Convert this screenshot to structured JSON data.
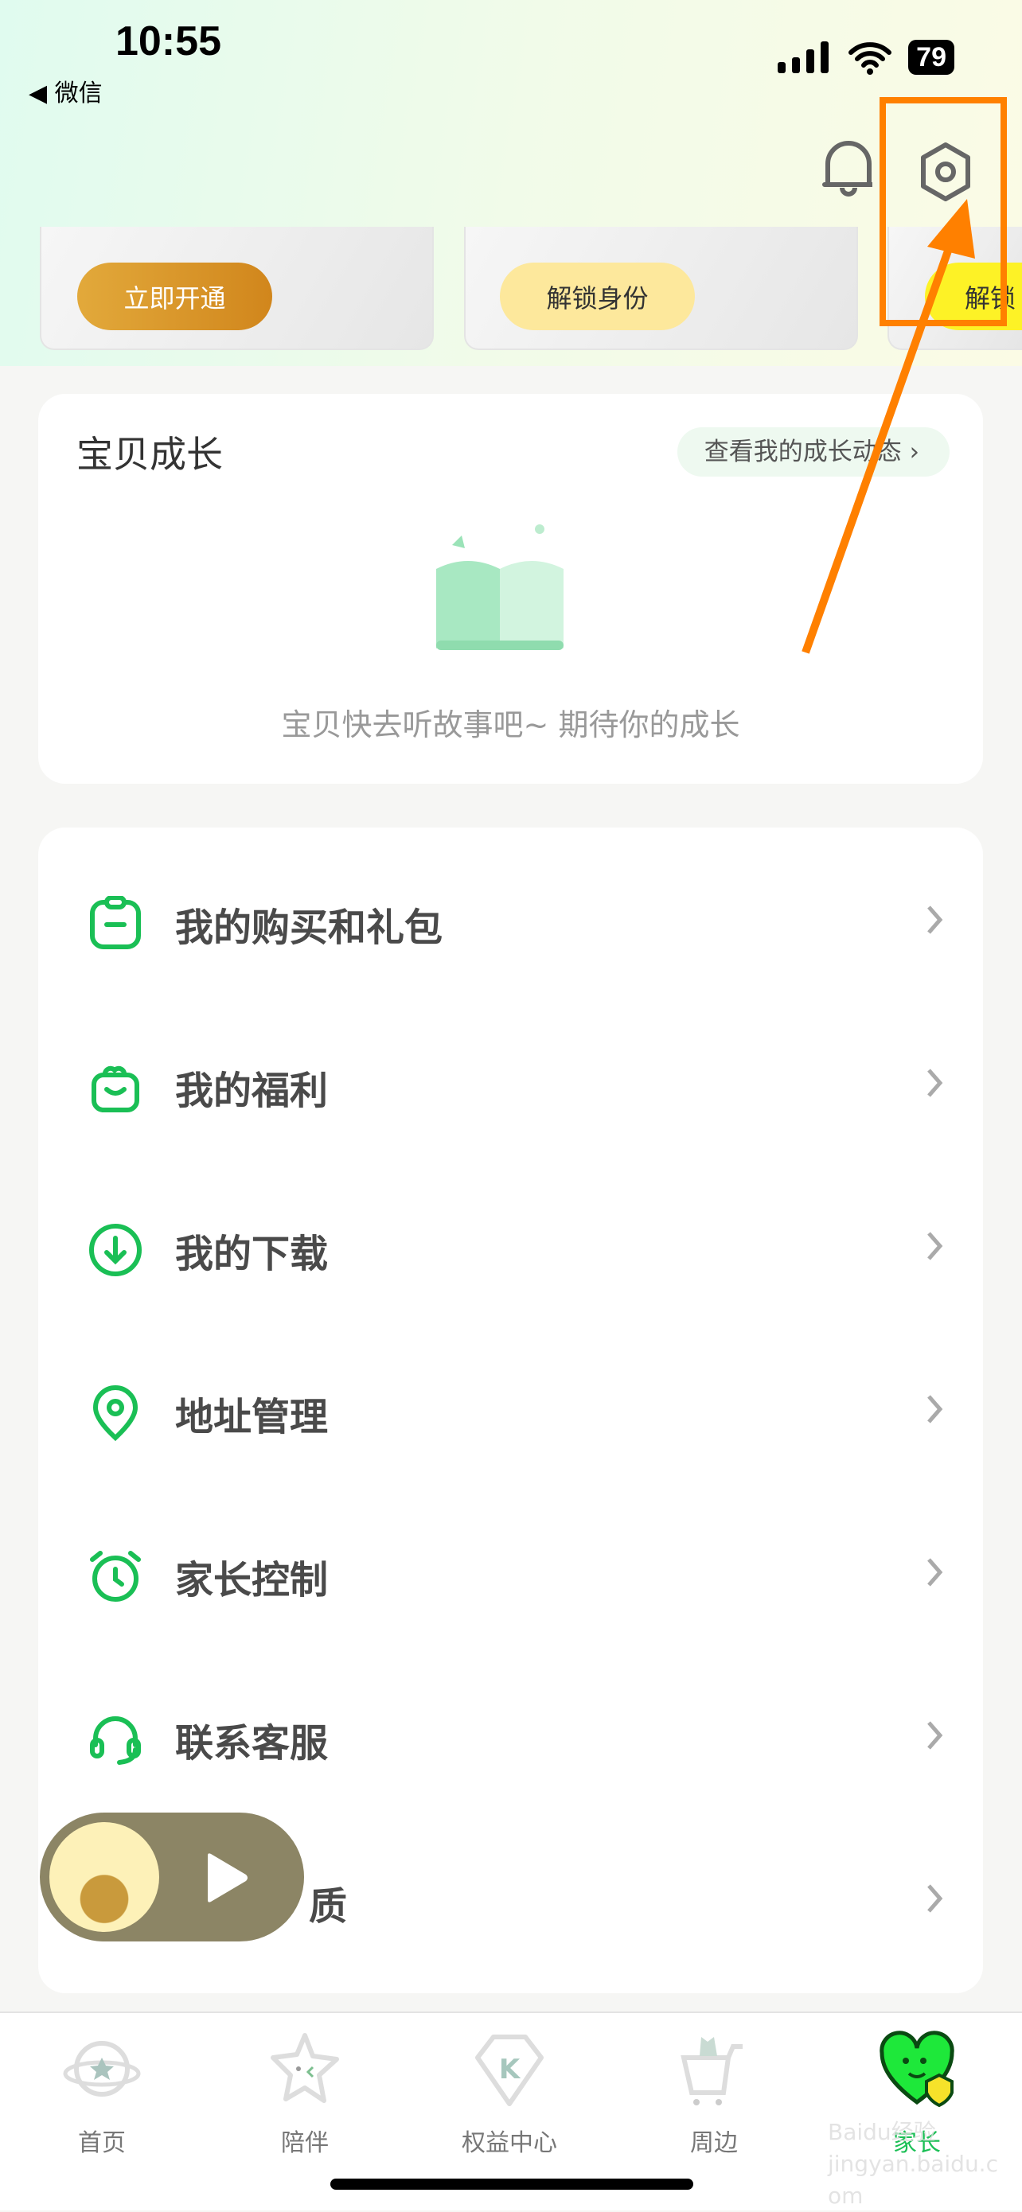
{
  "status_bar": {
    "time": "10:55",
    "back_app": "微信",
    "battery": "79"
  },
  "header": {
    "icons": [
      "bell-icon",
      "settings-gear-icon"
    ]
  },
  "membership_cards": [
    {
      "button": "立即开通"
    },
    {
      "button": "解锁身份"
    },
    {
      "button": "解锁"
    }
  ],
  "growth": {
    "title": "宝贝成长",
    "link": "查看我的成长动态",
    "empty_text": "宝贝快去听故事吧~ 期待你的成长"
  },
  "menu": [
    {
      "label": "我的购买和礼包",
      "icon": "clipboard-icon"
    },
    {
      "label": "我的福利",
      "icon": "gift-icon"
    },
    {
      "label": "我的下载",
      "icon": "download-icon"
    },
    {
      "label": "地址管理",
      "icon": "location-pin-icon"
    },
    {
      "label": "家长控制",
      "icon": "alarm-clock-icon"
    },
    {
      "label": "联系客服",
      "icon": "headset-icon"
    },
    {
      "label": "质",
      "icon": "hidden"
    }
  ],
  "tabs": [
    {
      "label": "首页"
    },
    {
      "label": "陪伴"
    },
    {
      "label": "权益中心"
    },
    {
      "label": "周边"
    },
    {
      "label": "家长",
      "active": true
    }
  ],
  "colors": {
    "accent": "#1abf55",
    "annotation": "#ff8000",
    "gold": "#d89a2a"
  },
  "watermark": "Baidu经验 jingyan.baidu.com"
}
